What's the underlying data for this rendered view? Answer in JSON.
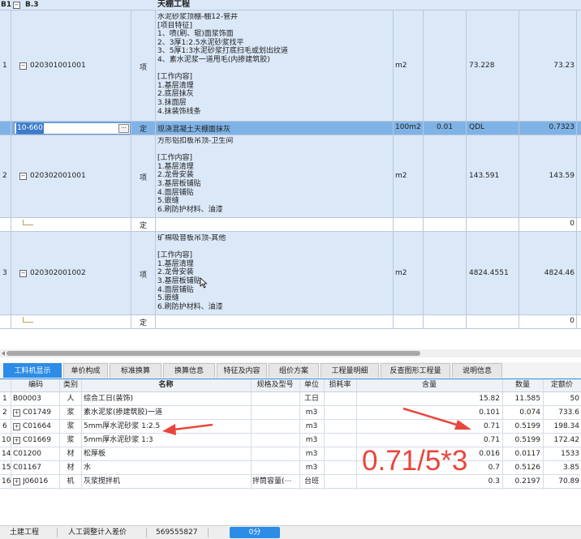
{
  "top_grid": {
    "header": {
      "b1": "B1",
      "code": "B.3",
      "title": "天棚工程"
    },
    "rows": [
      {
        "num": "1",
        "code": "020301001001",
        "type": "项",
        "desc": "水泥砂浆顶棚-棚12-管井\n[项目特征]\n1、喷(刷、辊)面浆饰面\n2、3厚1:2.5水泥砂浆找平\n3、5厚1:3水泥砂浆打底扫毛或划出纹道\n4、素水泥浆一道甩毛(内掺建筑胶)\n\n[工作内容]\n1.基层清理\n2.底层抹灰\n3.抹面层\n4.抹装饰线条",
        "unit": "m2",
        "qty": "73.228",
        "total": "73.23"
      },
      {
        "num": "",
        "code": "10-660",
        "type": "定",
        "desc": "现浇混凝土天棚面抹灰",
        "unit": "100m2",
        "coef": "0.01",
        "qty": "QDL",
        "total": "0.7323"
      },
      {
        "num": "2",
        "code": "020302001001",
        "type": "项",
        "desc": "方形铝扣板吊顶-卫生间\n\n[工作内容]\n1.基层清理\n2.龙骨安装\n3.基层板铺贴\n4.面层铺贴\n5.嵌缝\n6.刷防护材料、油漆",
        "unit": "m2",
        "qty": "143.591",
        "total": "143.59"
      },
      {
        "num": "",
        "code": "",
        "type": "定",
        "desc": "",
        "unit": "",
        "qty": "",
        "total": "0"
      },
      {
        "num": "3",
        "code": "020302001002",
        "type": "项",
        "desc": "矿棉吸音板吊顶-其他\n\n[工作内容]\n1.基层清理\n2.龙骨安装\n3.基层板铺贴\n4.面层铺贴\n5.嵌缝\n6.刷防护材料、油漆",
        "unit": "m2",
        "qty": "4824.4551",
        "total": "4824.46"
      },
      {
        "num": "",
        "code": "",
        "type": "定",
        "desc": "",
        "unit": "",
        "qty": "",
        "total": "0"
      }
    ]
  },
  "tabs": [
    "工料机显示",
    "单价构成",
    "标准换算",
    "换算信息",
    "特征及内容",
    "组价方案",
    "工程量明细",
    "反查图形工程量",
    "说明信息"
  ],
  "bottom_table": {
    "headers": [
      "编码",
      "类别",
      "名称",
      "规格及型号",
      "单位",
      "损耗率",
      "含量",
      "数量",
      "定额价"
    ],
    "rows": [
      {
        "idx": "1",
        "expand": false,
        "code": "B00003",
        "cat": "人",
        "name": "综合工日(装饰)",
        "spec": "",
        "unit": "工日",
        "loss": "",
        "content": "15.82",
        "qty": "11.585",
        "price": "50"
      },
      {
        "idx": "2",
        "expand": true,
        "code": "C01749",
        "cat": "浆",
        "name": "素水泥浆(掺建筑胶)一道",
        "spec": "",
        "unit": "m3",
        "loss": "",
        "content": "0.101",
        "qty": "0.074",
        "price": "733.6"
      },
      {
        "idx": "6",
        "expand": true,
        "code": "C01664",
        "cat": "浆",
        "name": "5mm厚水泥砂浆 1:2.5",
        "spec": "",
        "unit": "m3",
        "loss": "",
        "content": "0.71",
        "qty": "0.5199",
        "price": "198.34"
      },
      {
        "idx": "10",
        "expand": true,
        "code": "C01669",
        "cat": "浆",
        "name": "5mm厚水泥砂浆 1:3",
        "spec": "",
        "unit": "m3",
        "loss": "",
        "content": "0.71",
        "qty": "0.5199",
        "price": "172.42"
      },
      {
        "idx": "14",
        "expand": false,
        "code": "C01200",
        "cat": "材",
        "name": "松厚板",
        "spec": "",
        "unit": "m3",
        "loss": "",
        "content": "0.016",
        "qty": "0.0117",
        "price": "1533"
      },
      {
        "idx": "15",
        "expand": false,
        "code": "C01167",
        "cat": "材",
        "name": "水",
        "spec": "",
        "unit": "m3",
        "loss": "",
        "content": "0.7",
        "qty": "0.5126",
        "price": "3.85"
      },
      {
        "idx": "16",
        "expand": true,
        "code": "J06016",
        "cat": "机",
        "name": "灰浆搅拌机",
        "spec": "拌筒容量(⋯",
        "unit": "台班",
        "loss": "",
        "content": "0.3",
        "qty": "0.2197",
        "price": "70.89"
      }
    ]
  },
  "annotation": {
    "text": "0.71/5*3",
    "color": "#e8463c"
  },
  "status_bar": {
    "items": [
      "土建工程",
      "人工调整计入差价",
      "569555827"
    ],
    "button": "0分"
  },
  "colors": {
    "selection": "#dbe8f8",
    "active_row": "#7fb3e6",
    "tab_active": "#2c8ce6"
  }
}
